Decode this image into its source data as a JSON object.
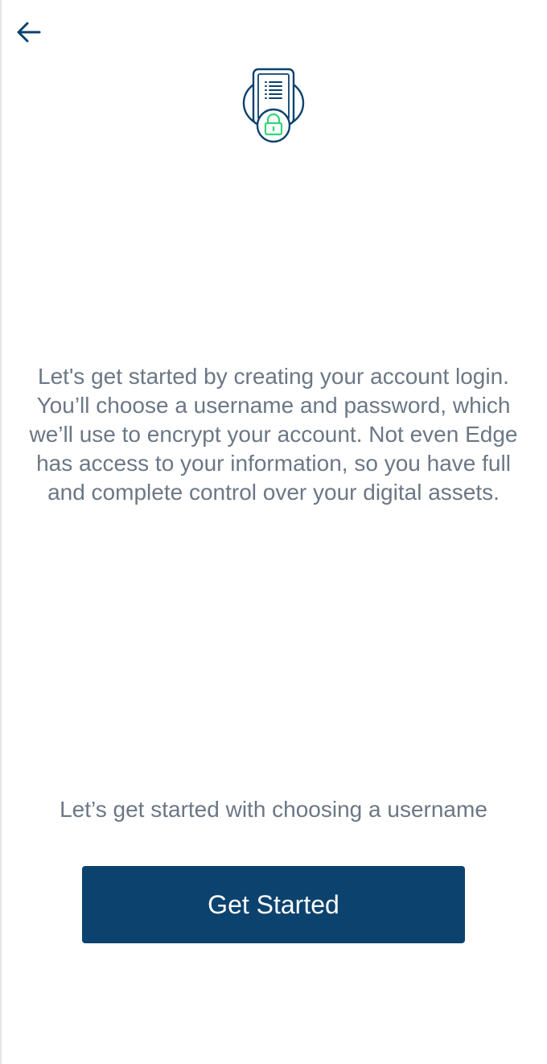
{
  "header": {
    "back_icon": "arrow-left-icon"
  },
  "hero": {
    "icon": "document-lock-icon"
  },
  "main": {
    "description": "Let's get started by creating your account login. You’ll choose a username and password, which we’ll use to encrypt your account. Not even Edge has access to your information, so you have full and complete control over your digital assets.",
    "prompt": "Let’s get started with choosing a username"
  },
  "footer": {
    "button_label": "Get Started"
  },
  "colors": {
    "primary": "#0c426e",
    "accent": "#33d57a",
    "text": "#6b7785"
  }
}
